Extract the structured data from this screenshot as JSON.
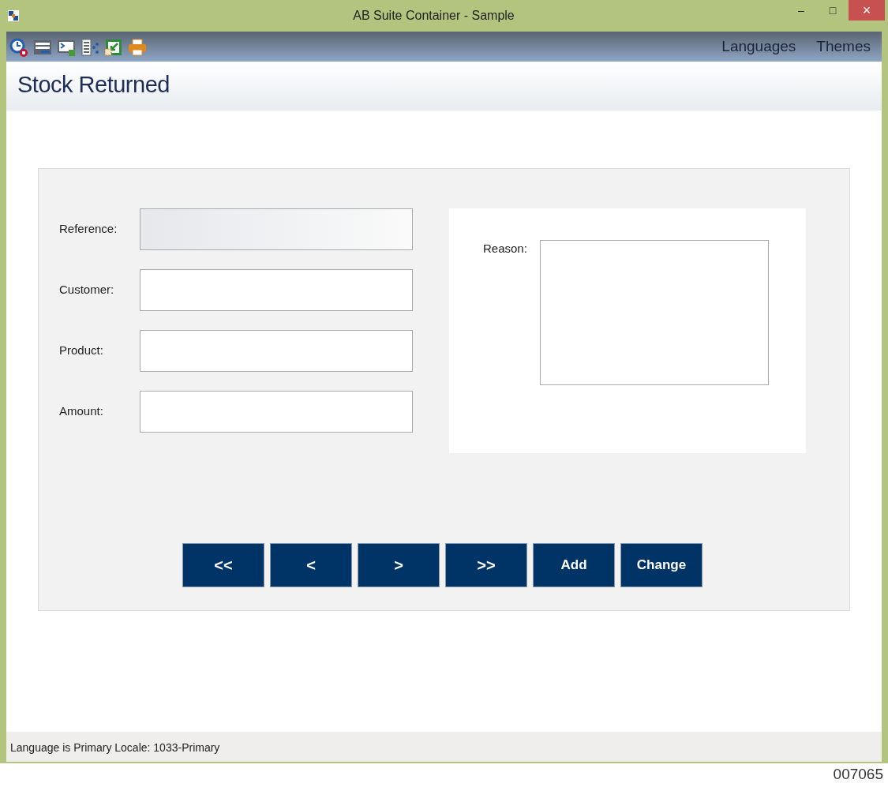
{
  "window": {
    "title": "AB Suite Container - Sample",
    "controls": [
      "–",
      "□",
      "×"
    ]
  },
  "toolbar": {
    "icons": [
      {
        "kind": "clock"
      },
      {
        "kind": "form"
      },
      {
        "kind": "console"
      },
      {
        "kind": "tree"
      },
      {
        "kind": "export"
      },
      {
        "kind": "print"
      }
    ],
    "menus": [
      "Languages",
      "Themes"
    ]
  },
  "page": {
    "title": "Stock Returned"
  },
  "form": {
    "fields": [
      {
        "label": "Reference:",
        "disabled": true
      },
      {
        "label": "Customer:",
        "disabled": false
      },
      {
        "label": "Product:",
        "disabled": false
      },
      {
        "label": "Amount:",
        "disabled": false
      }
    ],
    "reason": {
      "label": "Reason:"
    },
    "buttons": [
      "<<",
      "<",
      ">",
      ">>",
      "Add",
      "Change"
    ]
  },
  "status_bar": "Language is Primary Locale: 1033-Primary",
  "figure_number": "007065"
}
